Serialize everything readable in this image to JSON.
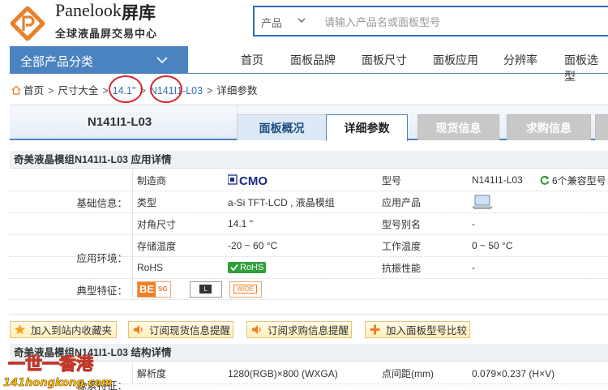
{
  "header": {
    "brand_name": "Panelook",
    "brand_cn": "屏库",
    "slogan": "全球液晶屏交易中心",
    "search_category": "产品",
    "search_placeholder": "请输入产品名或面板型号"
  },
  "nav": {
    "category_label": "全部产品分类",
    "items": [
      "首页",
      "面板品牌",
      "面板尺寸",
      "面板应用",
      "分辨率",
      "面板选型"
    ]
  },
  "breadcrumb": [
    "首页",
    "尺寸大全",
    "14.1\"",
    "N141I1-L03",
    "详细参数"
  ],
  "model": "N141I1-L03",
  "tabs": [
    "面板概况",
    "详细参数",
    "现货信息",
    "求购信息"
  ],
  "section1_title": "奇美液晶模组N141I1-L03 应用详情",
  "groups": {
    "basic": "基础信息：",
    "env": "应用环境：",
    "typical": "典型特征："
  },
  "rows": {
    "r1": {
      "l1": "制造商",
      "brand_logo": "CMO",
      "l2": "型号",
      "v2": "N141I1-L03",
      "compat": "6个兼容型号"
    },
    "r2": {
      "l1": "类型",
      "v1": "a-Si TFT-LCD , 液晶模组",
      "l2": "应用产品"
    },
    "r3": {
      "l1": "对角尺寸",
      "v1": "14.1 \"",
      "l2": "型号别名",
      "v2": "-"
    },
    "r4": {
      "l1": "存储温度",
      "v1": "-20 ~ 60 °C",
      "l2": "工作温度",
      "v2": "0 ~ 50 °C"
    },
    "r5": {
      "l1": "RoHS",
      "badge": "RoHS",
      "l2": "抗振性能",
      "v2": "-"
    }
  },
  "feature_badges": [
    "BE",
    "SG",
    "L",
    "WIDE"
  ],
  "actions": [
    "加入到站内收藏夹",
    "订阅现货信息提醒",
    "订阅求购信息提醒",
    "加入面板型号比较"
  ],
  "section2_title": "奇美液晶模组N141I1-L03 结构详情",
  "struct": {
    "group": "像素特征：",
    "l1": "解析度",
    "v1": "1280(RGB)×800 (WXGA)",
    "l2": "点间距(mm)",
    "v2": "0.079×0.237 (H×V)"
  },
  "watermark": {
    "line1": "一世一香港",
    "line2": "141hongkong.com"
  },
  "colors": {
    "accent": "#4b83c0",
    "brand_orange": "#e8812a",
    "annotation_red": "#d9232e"
  }
}
